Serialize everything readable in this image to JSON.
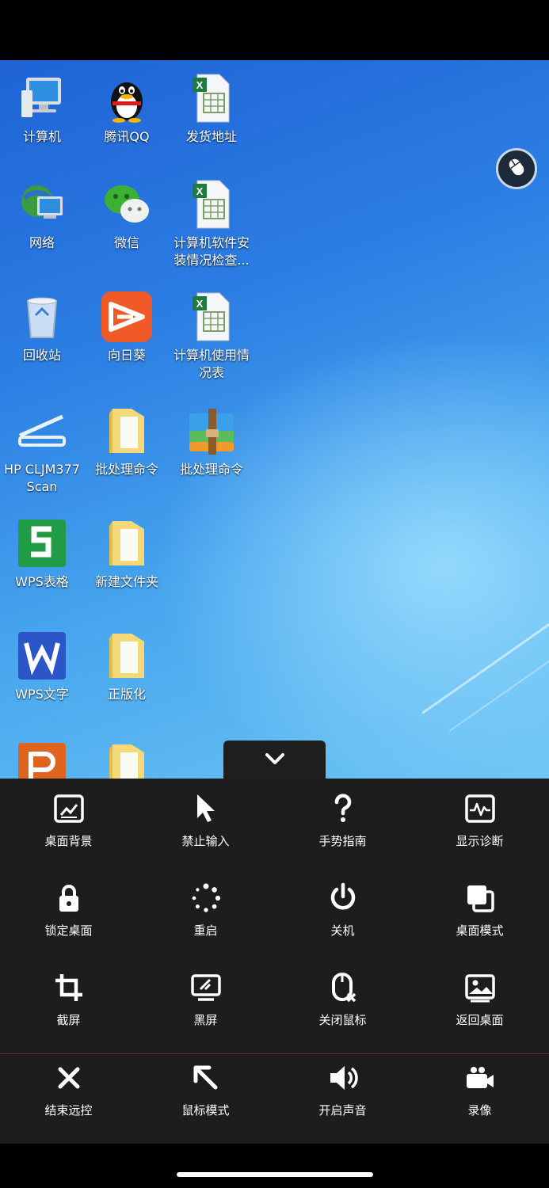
{
  "desktop": {
    "icons": [
      {
        "label": "计算机",
        "icon": "computer-icon"
      },
      {
        "label": "腾讯QQ",
        "icon": "qq-icon"
      },
      {
        "label": "发货地址",
        "icon": "excel-file-icon"
      },
      {
        "label": "网络",
        "icon": "network-icon"
      },
      {
        "label": "微信",
        "icon": "wechat-icon"
      },
      {
        "label": "计算机软件安装情况检查...",
        "icon": "excel-file-icon"
      },
      {
        "label": "回收站",
        "icon": "recycle-bin-icon"
      },
      {
        "label": "向日葵",
        "icon": "sunflower-icon"
      },
      {
        "label": "计算机使用情况表",
        "icon": "excel-file-icon"
      },
      {
        "label": "HP CLJM377 Scan",
        "icon": "scanner-icon"
      },
      {
        "label": "批处理命令",
        "icon": "folder-icon"
      },
      {
        "label": "批处理命令",
        "icon": "archive-icon"
      },
      {
        "label": "WPS表格",
        "icon": "wps-sheet-icon"
      },
      {
        "label": "新建文件夹",
        "icon": "folder-icon"
      },
      {
        "label": "WPS文字",
        "icon": "wps-writer-icon"
      },
      {
        "label": "正版化",
        "icon": "folder-icon"
      }
    ]
  },
  "toolbar": {
    "rows": [
      [
        {
          "label": "桌面背景",
          "icon": "wallpaper-icon"
        },
        {
          "label": "禁止输入",
          "icon": "cursor-icon"
        },
        {
          "label": "手势指南",
          "icon": "help-icon"
        },
        {
          "label": "显示诊断",
          "icon": "diagnostics-icon"
        }
      ],
      [
        {
          "label": "锁定桌面",
          "icon": "lock-icon"
        },
        {
          "label": "重启",
          "icon": "restart-icon"
        },
        {
          "label": "关机",
          "icon": "power-icon"
        },
        {
          "label": "桌面模式",
          "icon": "desktop-mode-icon"
        }
      ],
      [
        {
          "label": "截屏",
          "icon": "crop-icon"
        },
        {
          "label": "黑屏",
          "icon": "black-screen-icon"
        },
        {
          "label": "关闭鼠标",
          "icon": "mouse-off-icon"
        },
        {
          "label": "返回桌面",
          "icon": "return-desktop-icon"
        }
      ],
      [
        {
          "label": "结束远控",
          "icon": "close-icon"
        },
        {
          "label": "鼠标模式",
          "icon": "arrow-up-left-icon"
        },
        {
          "label": "开启声音",
          "icon": "volume-icon"
        },
        {
          "label": "录像",
          "icon": "record-icon"
        }
      ]
    ]
  },
  "colors": {
    "panel_bg": "#1d1d1d",
    "divider": "#7a2222",
    "desktop_blue": "#2c7ee3"
  }
}
